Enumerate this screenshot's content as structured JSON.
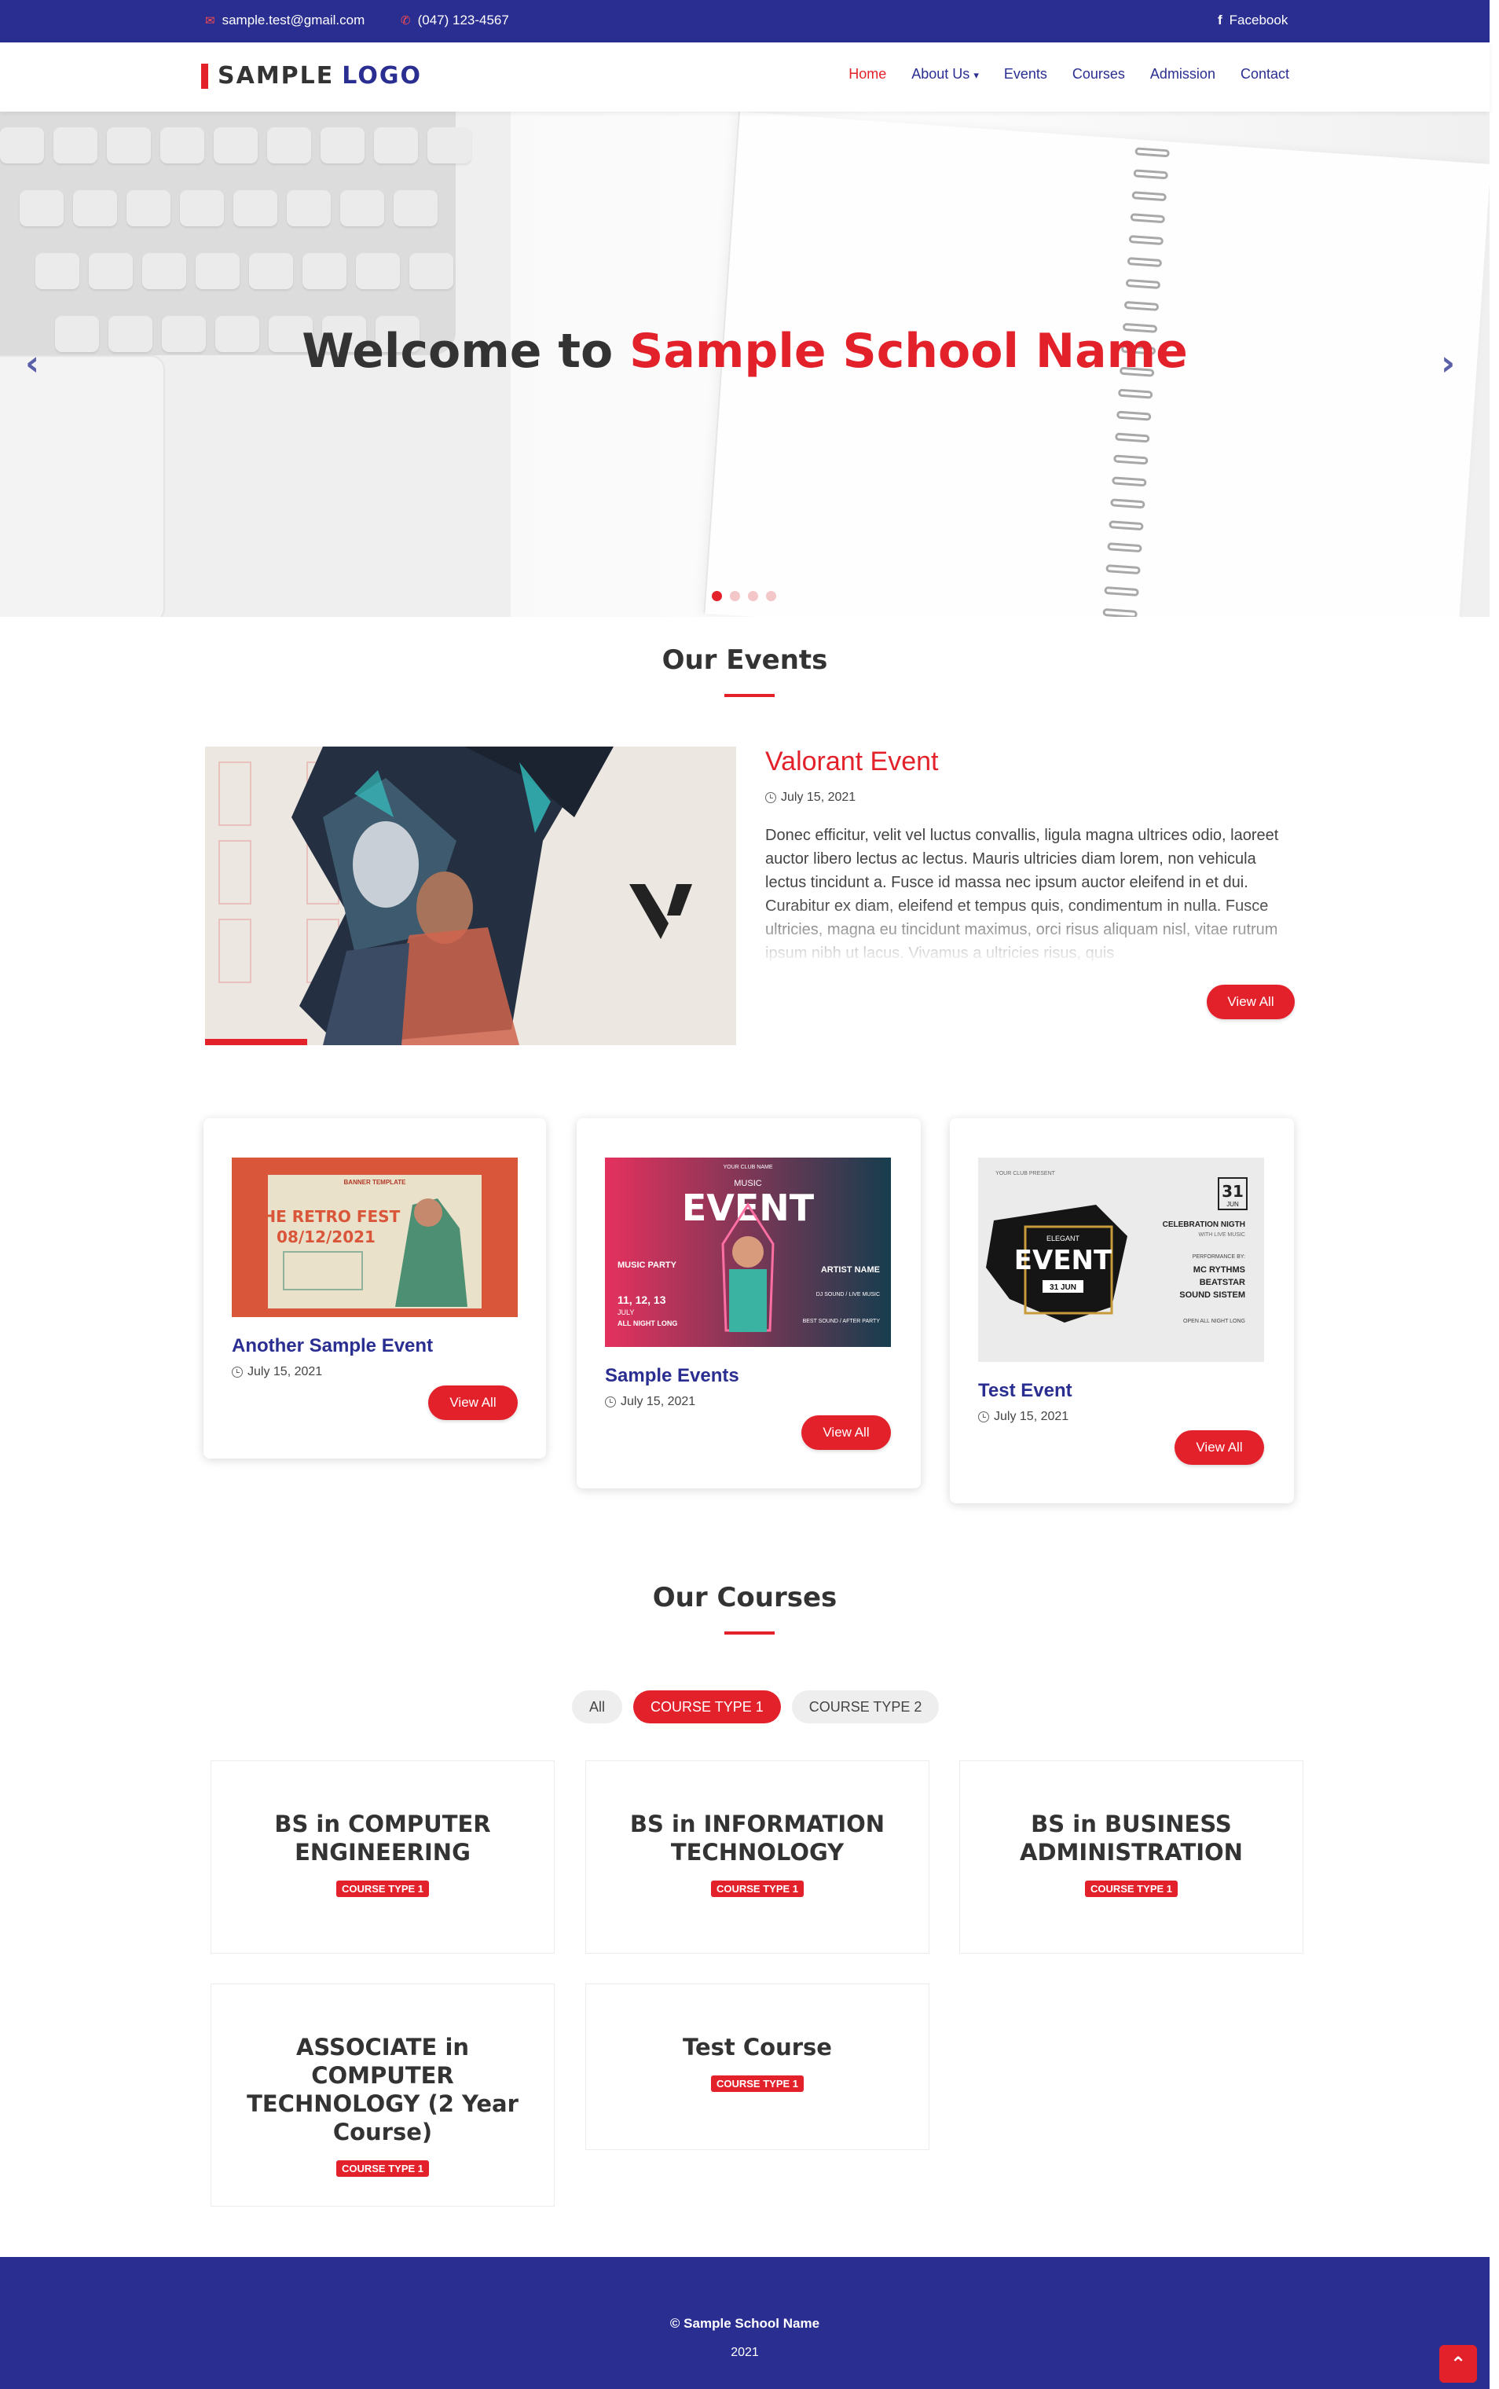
{
  "topbar": {
    "email": "sample.test@gmail.com",
    "phone": "(047) 123-4567",
    "facebook": "Facebook",
    "facebook_glyph": "f"
  },
  "logo": {
    "part1": "SAMPLE",
    "part2": "LOGO"
  },
  "nav": {
    "home": "Home",
    "about": "About Us",
    "events": "Events",
    "courses": "Courses",
    "admission": "Admission",
    "contact": "Contact"
  },
  "hero": {
    "title_prefix": "Welcome to",
    "title_highlight": "Sample School Name",
    "prev_glyph": "‹",
    "next_glyph": "›",
    "slide_count": 4,
    "active_slide": 1
  },
  "events": {
    "heading": "Our Events",
    "featured": {
      "title": "Valorant Event",
      "date": "July 15, 2021",
      "body": "Donec efficitur, velit vel luctus convallis, ligula magna ultrices odio, laoreet auctor libero lectus ac lectus. Mauris ultricies diam lorem, non vehicula lectus tincidunt a. Fusce id massa nec ipsum auctor eleifend in et dui. Curabitur ex diam, eleifend et tempus quis, condimentum in nulla. Fusce ultricies, magna eu tincidunt maximus, orci risus aliquam nisl, vitae rutrum ipsum nibh ut lacus. Vivamus a ultricies risus, quis",
      "button": "View All"
    },
    "cards": [
      {
        "title": "Another Sample Event",
        "date": "July 15, 2021",
        "button": "View All",
        "poster": {
          "tag": "BANNER TEMPLATE",
          "line1": "THE RETRO FEST",
          "line2": "08/12/2021"
        }
      },
      {
        "title": "Sample Events",
        "date": "July 15, 2021",
        "button": "View All",
        "poster": {
          "club": "YOUR CLUB NAME",
          "small": "MUSIC",
          "big": "EVENT",
          "left1": "MUSIC PARTY",
          "dates": "11, 12, 13",
          "month": "JULY",
          "night": "ALL NIGHT LONG",
          "artist": "ARTIST NAME",
          "right1": "DJ SOUND / LIVE MUSIC",
          "right2": "BEST SOUND / AFTER PARTY"
        }
      },
      {
        "title": "Test Event",
        "date": "July 15, 2021",
        "button": "View All",
        "poster": {
          "club": "YOUR CLUB PRESENT",
          "elegant": "ELEGANT",
          "big": "EVENT",
          "date_small": "31 JUN",
          "day": "31",
          "mon": "JUN",
          "c1": "CELEBRATION NIGTH",
          "c2": "WITH LIVE MUSIC",
          "c3": "PERFORMANCE BY:",
          "c4": "MC RYTHMS",
          "c5": "BEATSTAR",
          "c6": "SOUND SISTEM",
          "c7": "OPEN ALL NIGHT LONG"
        }
      }
    ]
  },
  "courses": {
    "heading": "Our Courses",
    "filters": [
      "All",
      "COURSE TYPE 1",
      "COURSE TYPE 2"
    ],
    "active_filter": "COURSE TYPE 1",
    "items": [
      {
        "title": "BS in COMPUTER ENGINEERING",
        "badge": "COURSE TYPE 1"
      },
      {
        "title": "BS in INFORMATION TECHNOLOGY",
        "badge": "COURSE TYPE 1"
      },
      {
        "title": "BS in BUSINESS ADMINISTRATION",
        "badge": "COURSE TYPE 1"
      },
      {
        "title": "ASSOCIATE in COMPUTER TECHNOLOGY (2 Year Course)",
        "badge": "COURSE TYPE 1"
      },
      {
        "title": "Test Course",
        "badge": "COURSE TYPE 1"
      }
    ]
  },
  "footer": {
    "copyright": "© Sample School Name",
    "year": "2021"
  },
  "back_to_top_glyph": "⌃",
  "colors": {
    "brand_blue": "#2a2e91",
    "accent_red": "#e3212b"
  }
}
